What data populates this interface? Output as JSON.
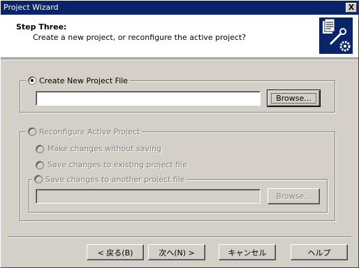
{
  "window": {
    "title": "Project Wizard",
    "close_label": "X"
  },
  "header": {
    "step_title": "Step Three:",
    "step_desc": "Create a new project, or reconfigure the active project?",
    "icon": "wizard-tools-icon"
  },
  "create_group": {
    "label": "Create New Project File",
    "selected": true,
    "path_value": "",
    "browse_label": "Browse..."
  },
  "reconfigure_group": {
    "label": "Reconfigure Active Project",
    "enabled": false,
    "options": [
      {
        "label": "Make changes without saving"
      },
      {
        "label": "Save changes to existing project file"
      }
    ],
    "another_file": {
      "label": "Save changes to another project file",
      "path_value": "",
      "browse_label": "Browse..."
    }
  },
  "buttons": {
    "back": "< 戻る(B)",
    "next": "次へ(N) >",
    "cancel": "キャンセル",
    "help": "ヘルプ"
  },
  "colors": {
    "titlebar": "#0a246a",
    "face": "#d4d0c8",
    "disabled_text": "#808080"
  }
}
